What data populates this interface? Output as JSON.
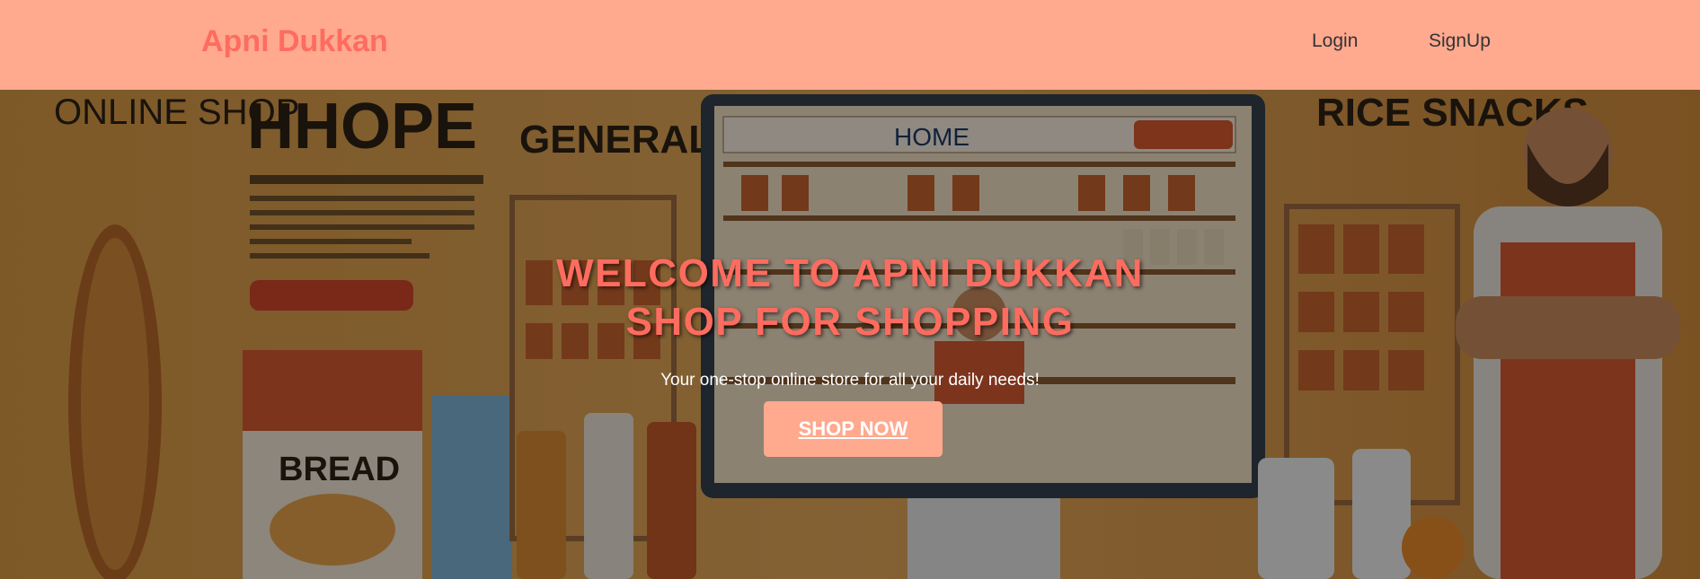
{
  "navbar": {
    "brand": "Apni Dukkan",
    "links": [
      {
        "label": "Login"
      },
      {
        "label": "SignUp"
      }
    ]
  },
  "hero": {
    "title_line1": "WELCOME TO APNI DUKKAN",
    "title_line2": "SHOP FOR SHOPPING",
    "subtitle": "Your one-stop online store for all your daily needs!",
    "cta_label": "SHOP NOW",
    "image_text": {
      "online_shop": "ONLINE SHOP",
      "hhope": "HHOPE",
      "general_store": "GENERAL STORE",
      "home": "HOME",
      "rice_snacks": "RICE SNACKS",
      "bread": "BREAD"
    }
  },
  "colors": {
    "navbar_bg": "#ffa98f",
    "brand": "#fe6c5f",
    "title": "#fe6c5f",
    "button_bg": "#ffa98f",
    "button_text": "#ffffff"
  }
}
